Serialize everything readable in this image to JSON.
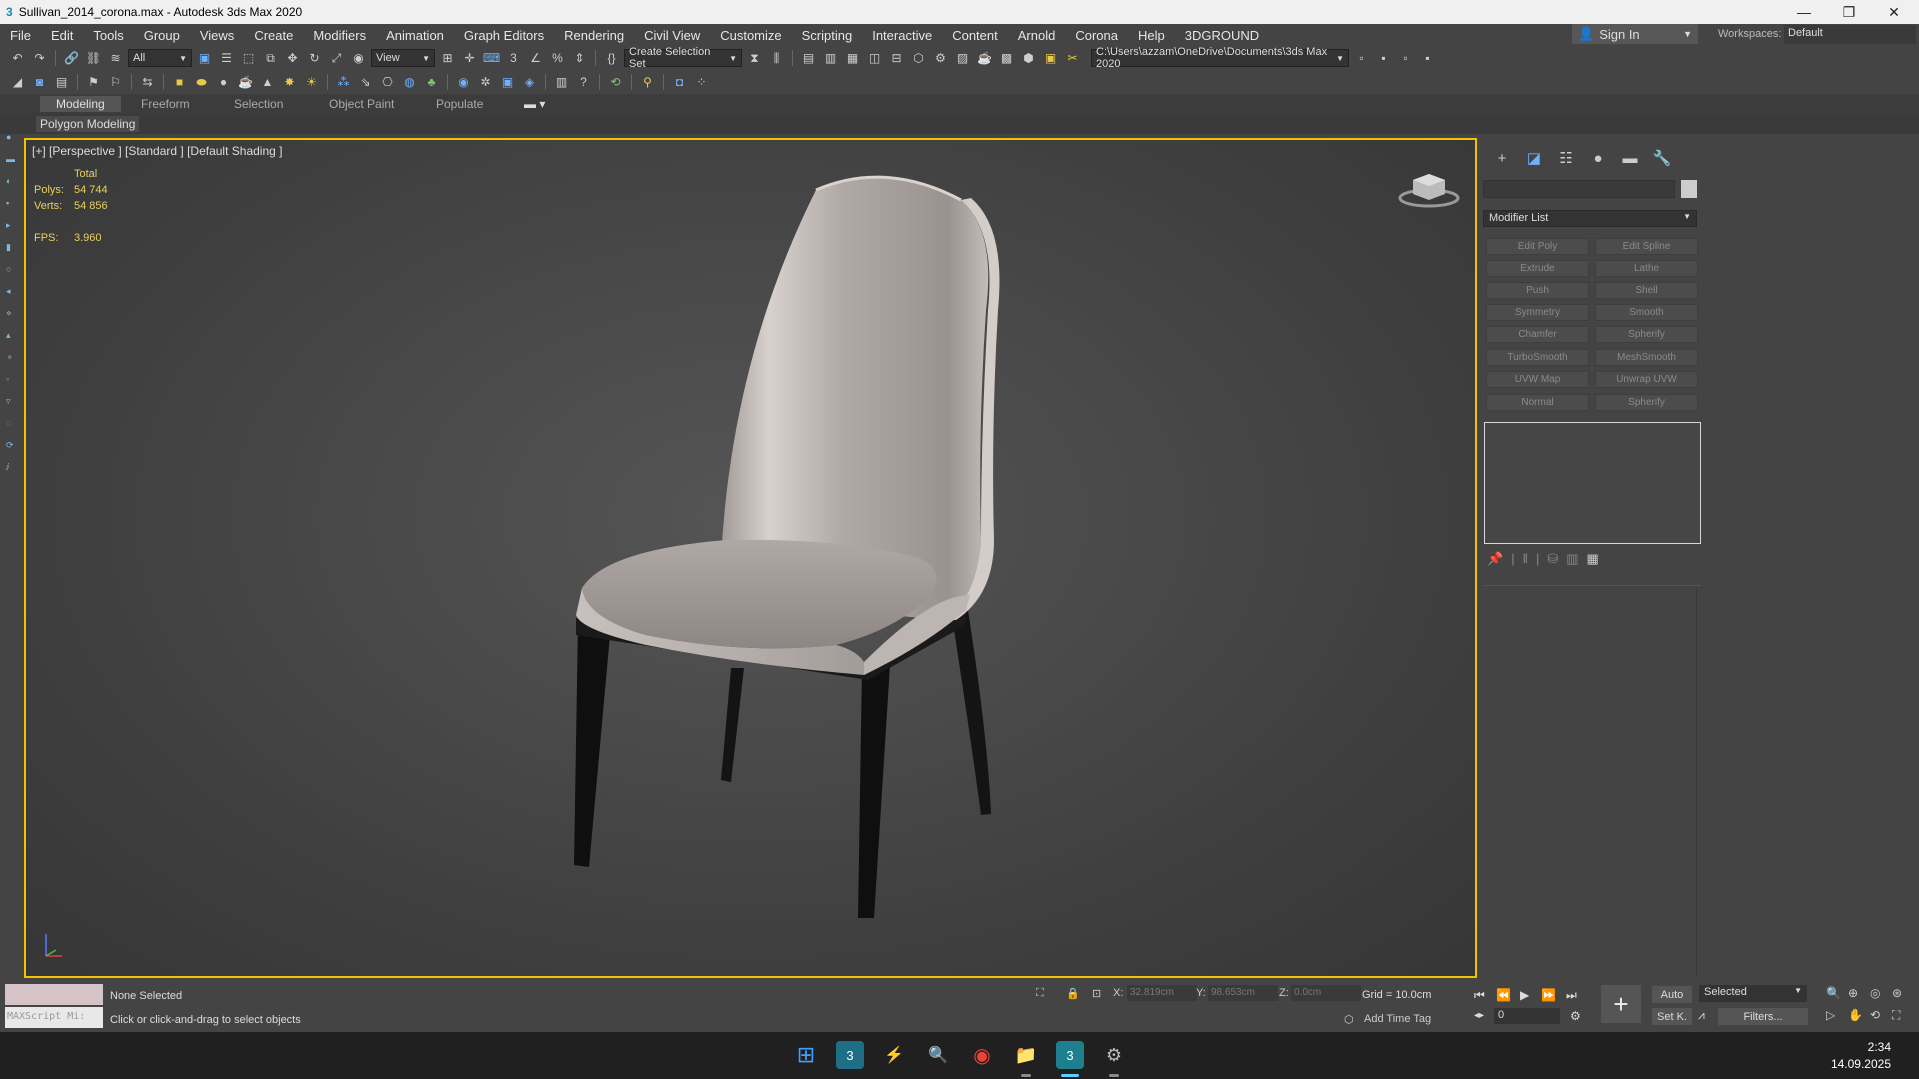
{
  "window": {
    "title": "Sullivan_2014_corona.max - Autodesk 3ds Max 2020",
    "minimize": "—",
    "maximize": "❐",
    "close": "✕"
  },
  "menu": [
    "File",
    "Edit",
    "Tools",
    "Group",
    "Views",
    "Create",
    "Modifiers",
    "Animation",
    "Graph Editors",
    "Rendering",
    "Civil View",
    "Customize",
    "Scripting",
    "Interactive",
    "Content",
    "Arnold",
    "Corona",
    "Help",
    "3DGROUND"
  ],
  "account": {
    "sign_in": "Sign In",
    "workspaces_label": "Workspaces:",
    "workspace_value": "Default"
  },
  "toolbar": {
    "filter_value": "All",
    "ref_coord_value": "View",
    "selection_set_value": "Create Selection Set",
    "project_path": "C:\\Users\\azzam\\OneDrive\\Documents\\3ds Max 2020"
  },
  "ribbon": {
    "tabs": [
      "Modeling",
      "Freeform",
      "Selection",
      "Object Paint",
      "Populate"
    ],
    "active_tab": "Modeling",
    "panel_label": "Polygon Modeling"
  },
  "viewport": {
    "label": "[+] [Perspective ] [Standard ] [Default Shading ]",
    "stats": {
      "total_label": "Total",
      "polys_label": "Polys:",
      "polys_value": "54 744",
      "verts_label": "Verts:",
      "verts_value": "54 856",
      "fps_label": "FPS:",
      "fps_value": "3.960"
    }
  },
  "command_panel": {
    "modifier_list_label": "Modifier List",
    "modifiers": [
      "Edit Poly",
      "Edit Spline",
      "Extrude",
      "Lathe",
      "Push",
      "Shell",
      "Symmetry",
      "Smooth",
      "Chamfer",
      "Spherify",
      "TurboSmooth",
      "MeshSmooth",
      "UVW Map",
      "Unwrap UVW",
      "Normal",
      "Spherify"
    ]
  },
  "status": {
    "maxscript_label": "MAXScript Mi:",
    "selection_status": "None Selected",
    "prompt": "Click or click-and-drag to select objects",
    "x_label": "X:",
    "x_value": "32.819cm",
    "y_label": "Y:",
    "y_value": "98.653cm",
    "z_label": "Z:",
    "z_value": "0.0cm",
    "grid": "Grid = 10.0cm",
    "add_time_tag": "Add Time Tag",
    "frame_value": "0",
    "auto_label": "Auto",
    "setk_label": "Set K.",
    "selected_value": "Selected",
    "filters_label": "Filters..."
  },
  "taskbar": {
    "time": "2:34",
    "date": "14.09.2025"
  },
  "colors": {
    "viewport_border": "#f2c200",
    "stats_text": "#e8d060"
  }
}
